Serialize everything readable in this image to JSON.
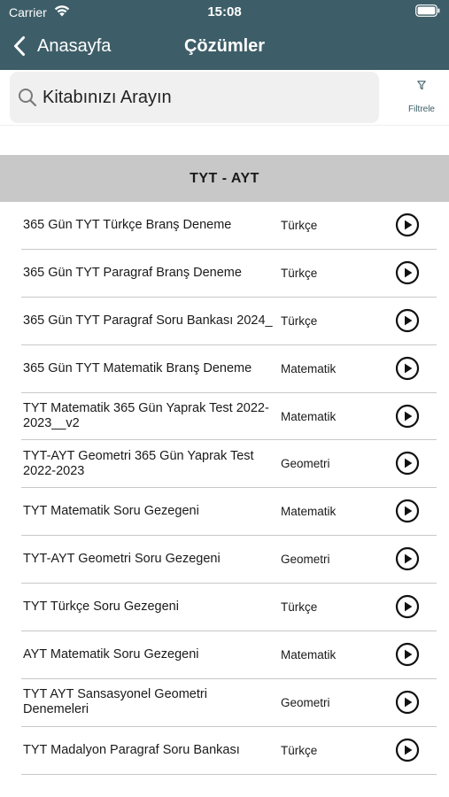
{
  "status_bar": {
    "carrier": "Carrier",
    "time": "15:08"
  },
  "nav": {
    "back_label": "Anasayfa",
    "title": "Çözümler"
  },
  "search": {
    "placeholder": "Kitabınızı Arayın"
  },
  "filter": {
    "label": "Filtrele"
  },
  "section": {
    "title": "TYT - AYT"
  },
  "items": [
    {
      "title": "365 Gün TYT Türkçe Branş Deneme",
      "subject": "Türkçe"
    },
    {
      "title": "365 Gün TYT Paragraf Branş Deneme",
      "subject": "Türkçe"
    },
    {
      "title": "365 Gün TYT Paragraf Soru Bankası 2024_",
      "subject": "Türkçe"
    },
    {
      "title": "365 Gün TYT Matematik Branş Deneme",
      "subject": "Matematik"
    },
    {
      "title": "TYT Matematik 365 Gün Yaprak Test 2022-2023__v2",
      "subject": "Matematik"
    },
    {
      "title": "TYT-AYT Geometri 365 Gün Yaprak Test 2022-2023",
      "subject": "Geometri"
    },
    {
      "title": "TYT Matematik Soru Gezegeni",
      "subject": "Matematik"
    },
    {
      "title": "TYT-AYT Geometri Soru Gezegeni",
      "subject": "Geometri"
    },
    {
      "title": "TYT Türkçe Soru Gezegeni",
      "subject": "Türkçe"
    },
    {
      "title": "AYT Matematik Soru Gezegeni",
      "subject": "Matematik"
    },
    {
      "title": "TYT AYT  Sansasyonel Geometri Denemeleri",
      "subject": "Geometri"
    },
    {
      "title": "TYT Madalyon Paragraf Soru Bankası",
      "subject": "Türkçe"
    }
  ],
  "icons": {
    "wifi": "wifi-icon",
    "battery": "battery-icon",
    "back": "chevron-left-icon",
    "search": "search-icon",
    "filter": "filter-icon",
    "play": "play-circle-icon"
  },
  "colors": {
    "header_bg": "#3d5e68",
    "section_bg": "#c8c8c8",
    "search_bg": "#f0f0f0"
  }
}
